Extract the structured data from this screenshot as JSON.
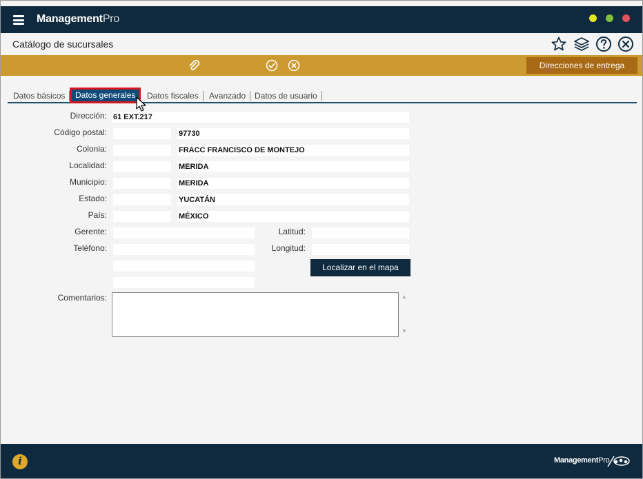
{
  "app": {
    "brand_bold": "Management",
    "brand_light": "Pro"
  },
  "header": {
    "title": "Catálogo de sucursales"
  },
  "toolbar": {
    "delivery_button": "Direcciones de entrega"
  },
  "tabs": [
    {
      "label": "Datos básicos",
      "active": false
    },
    {
      "label": "Datos generales",
      "active": true
    },
    {
      "label": "Datos fiscales",
      "active": false
    },
    {
      "label": "Avanzado",
      "active": false
    },
    {
      "label": "Datos de usuario",
      "active": false
    }
  ],
  "form": {
    "direccion": {
      "label": "Dirección:",
      "value": "61 EXT.217"
    },
    "codigo_postal": {
      "label": "Código postal:",
      "value": "97730"
    },
    "colonia": {
      "label": "Colonia:",
      "value": "FRACC FRANCISCO DE MONTEJO"
    },
    "localidad": {
      "label": "Localidad:",
      "value": "MERIDA"
    },
    "municipio": {
      "label": "Municipio:",
      "value": "MERIDA"
    },
    "estado": {
      "label": "Estado:",
      "value": "YUCATÁN"
    },
    "pais": {
      "label": "País:",
      "value": "MÉXICO"
    },
    "gerente": {
      "label": "Gerente:",
      "value": ""
    },
    "telefono": {
      "label": "Teléfono:",
      "value": ""
    },
    "latitud": {
      "label": "Latitud:",
      "value": ""
    },
    "longitud": {
      "label": "Longitud:",
      "value": ""
    },
    "map_button": "Localizar en el mapa",
    "comentarios": {
      "label": "Comentarios:",
      "value": ""
    }
  },
  "footer": {
    "brand_bold": "Management",
    "brand_light": "Pro"
  },
  "colors": {
    "navy": "#0f2a3f",
    "gold": "#cc9a2e",
    "dark_gold": "#a86a14",
    "tab_active": "#0f4a78",
    "highlight": "#d6161e"
  }
}
